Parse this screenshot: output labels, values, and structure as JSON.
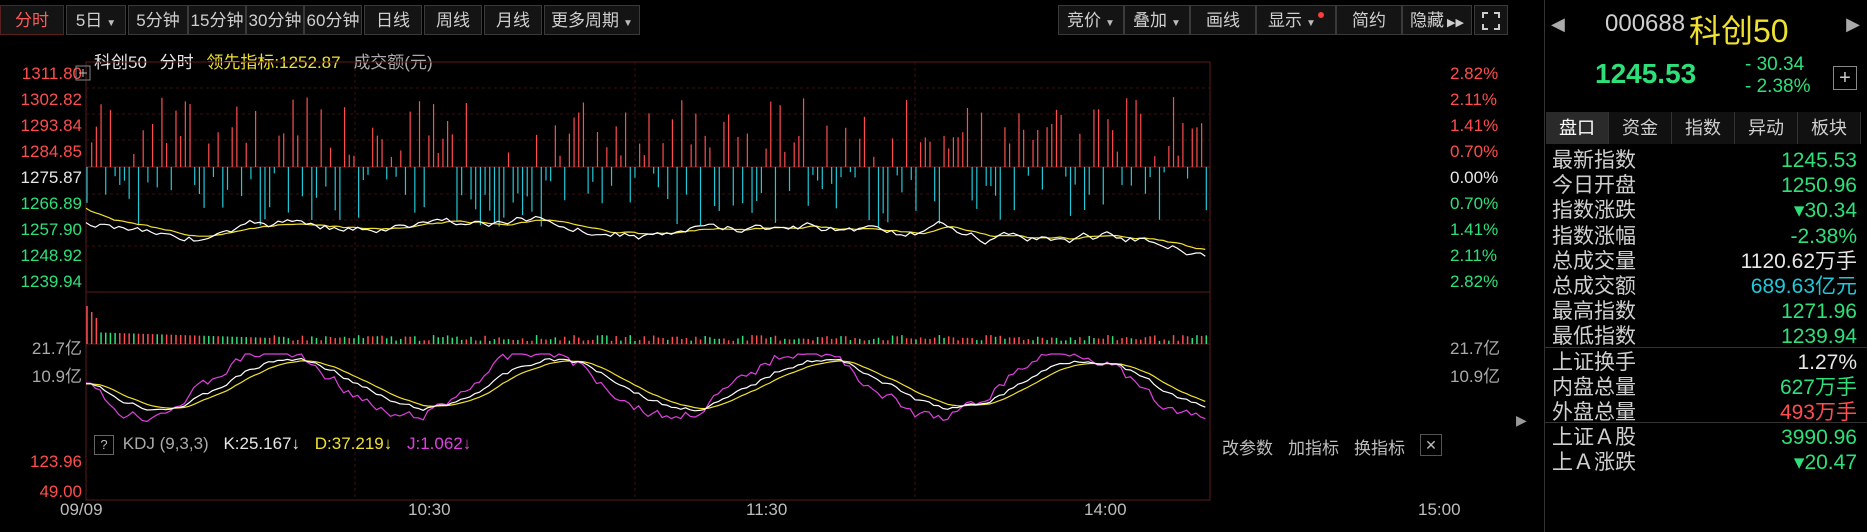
{
  "toolbar": {
    "items": [
      "分时",
      "5日",
      "5分钟",
      "15分钟",
      "30分钟",
      "60分钟",
      "日线",
      "周线",
      "月线",
      "更多周期"
    ],
    "right_items": [
      "竞价",
      "叠加",
      "画线",
      "显示",
      "简约",
      "隐藏"
    ]
  },
  "legend": {
    "name": "科创50",
    "mode": "分时",
    "lead_label": "领先指标:",
    "lead_value": "1252.87",
    "amount_label": "成交额(元)"
  },
  "price_axis_left": [
    "1311.80",
    "1302.82",
    "1293.84",
    "1284.85",
    "1275.87",
    "1266.89",
    "1257.90",
    "1248.92",
    "1239.94"
  ],
  "pct_axis_right": [
    "2.82%",
    "2.11%",
    "1.41%",
    "0.70%",
    "0.00%",
    "0.70%",
    "1.41%",
    "2.11%",
    "2.82%"
  ],
  "volume_axis": {
    "top": "21.7亿",
    "mid": "10.9亿"
  },
  "kdj": {
    "help": "?",
    "name": "KDJ (9,3,3)",
    "k": "K:25.167↓",
    "d": "D:37.219↓",
    "j": "J:1.062↓",
    "y_top": "123.96",
    "y_mid": "49.00",
    "buttons": [
      "改参数",
      "加指标",
      "换指标"
    ],
    "close": "✕"
  },
  "time_axis": [
    "09/09",
    "10:30",
    "11:30",
    "14:00",
    "15:00"
  ],
  "panel": {
    "code": "000688",
    "name": "科创50",
    "price": "1245.53",
    "change": "- 30.34",
    "change_pct": "- 2.38%",
    "add": "+",
    "tabs": [
      "盘口",
      "资金",
      "指数",
      "异动",
      "板块"
    ],
    "rows": [
      {
        "k": "最新指数",
        "v": "1245.53",
        "c": "green"
      },
      {
        "k": "今日开盘",
        "v": "1250.96",
        "c": "green"
      },
      {
        "k": "指数涨跌",
        "v": "▾30.34",
        "c": "green"
      },
      {
        "k": "指数涨幅",
        "v": "-2.38%",
        "c": "green"
      },
      {
        "k": "总成交量",
        "v": "1120.62万手",
        "c": "white"
      },
      {
        "k": "总成交额",
        "v": "689.63亿元",
        "c": "cyan"
      },
      {
        "k": "最高指数",
        "v": "1271.96",
        "c": "green"
      },
      {
        "k": "最低指数",
        "v": "1239.94",
        "c": "green"
      },
      {
        "k": "上证换手",
        "v": "1.27%",
        "c": "white"
      },
      {
        "k": "内盘总量",
        "v": "627万手",
        "c": "green"
      },
      {
        "k": "外盘总量",
        "v": "493万手",
        "c": "red"
      },
      {
        "k": "上证Ａ股",
        "v": "3990.96",
        "c": "green"
      },
      {
        "k": "上Ａ涨跌",
        "v": "▾20.47",
        "c": "green"
      }
    ]
  },
  "colors": {
    "up": "#ff4d4d",
    "down": "#2ee07a",
    "cyan": "#21c8d8",
    "price_line": "#ffffff",
    "lead_line": "#f0e030"
  }
}
